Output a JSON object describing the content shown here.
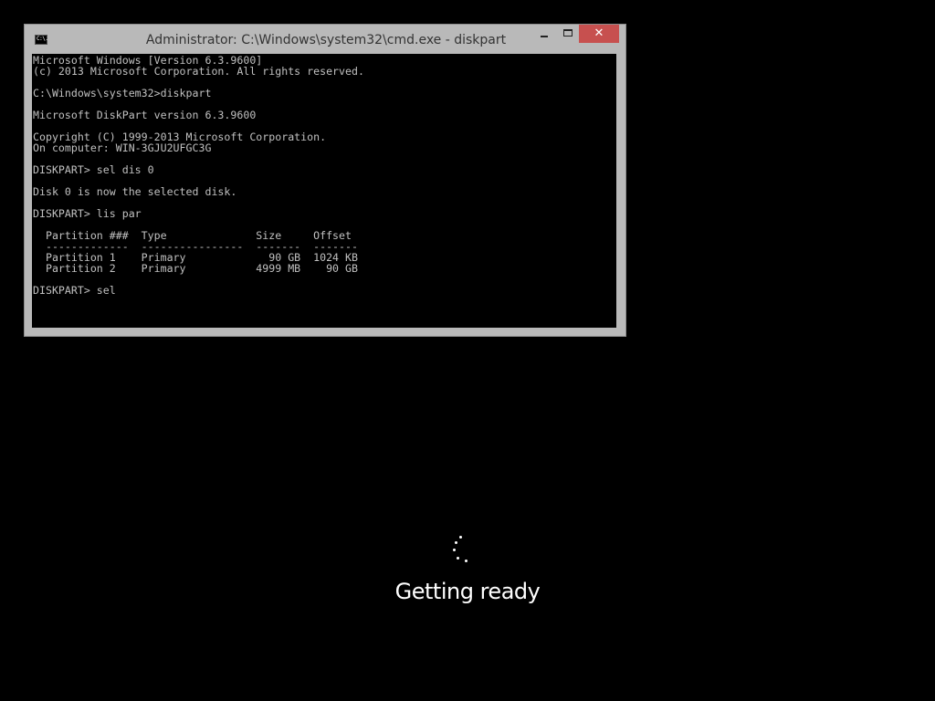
{
  "window": {
    "title": "Administrator: C:\\Windows\\system32\\cmd.exe - diskpart",
    "icon_label": "C:\\.",
    "close_glyph": "✕"
  },
  "console": {
    "lines": [
      "Microsoft Windows [Version 6.3.9600]",
      "(c) 2013 Microsoft Corporation. All rights reserved.",
      "",
      "C:\\Windows\\system32>diskpart",
      "",
      "Microsoft DiskPart version 6.3.9600",
      "",
      "Copyright (C) 1999-2013 Microsoft Corporation.",
      "On computer: WIN-3GJU2UFGC3G",
      "",
      "DISKPART> sel dis 0",
      "",
      "Disk 0 is now the selected disk.",
      "",
      "DISKPART> lis par",
      "",
      "  Partition ###  Type              Size     Offset",
      "  -------------  ----------------  -------  -------",
      "  Partition 1    Primary             90 GB  1024 KB",
      "  Partition 2    Primary           4999 MB    90 GB",
      "",
      "DISKPART> sel"
    ]
  },
  "status": {
    "text": "Getting ready",
    "spinner_icon": "loading-dots-icon"
  },
  "colors": {
    "background": "#000000",
    "window_frame": "#b9b9b9",
    "close_button": "#c7504f",
    "console_text": "#c0c0c0"
  }
}
